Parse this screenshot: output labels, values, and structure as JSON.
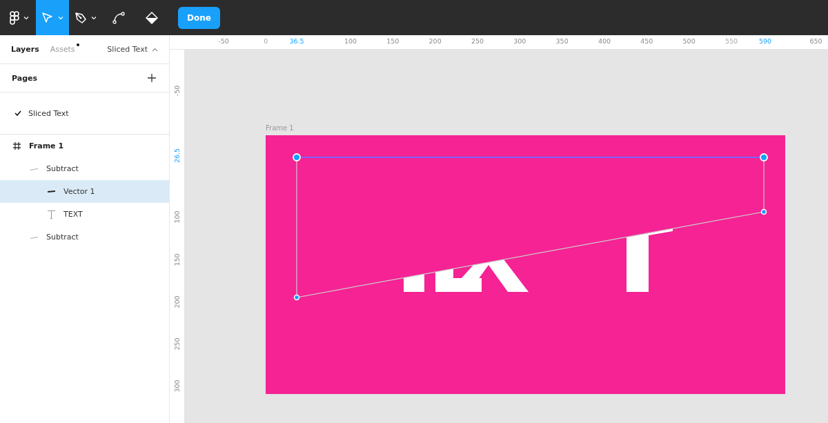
{
  "toolbar": {
    "tools": [
      {
        "kind": "main-menu",
        "selected": false,
        "caret": true
      },
      {
        "kind": "move",
        "selected": true,
        "caret": true
      },
      {
        "kind": "pen",
        "selected": false,
        "caret": true
      },
      {
        "kind": "bend",
        "selected": false,
        "caret": false
      },
      {
        "kind": "paint-bucket",
        "selected": false,
        "caret": false
      }
    ],
    "done_button": "Done"
  },
  "panel": {
    "tabs": [
      {
        "label": "Layers",
        "selected": true,
        "dot": false
      },
      {
        "label": "Assets",
        "selected": false,
        "dot": true
      }
    ],
    "page_switcher": "Sliced Text",
    "pages_title": "Pages",
    "pages": [
      {
        "name": "Sliced Text",
        "selected": true
      }
    ],
    "layers": [
      {
        "name": "Frame 1",
        "kind": "frame",
        "selected": false,
        "children": [
          {
            "name": "Subtract",
            "kind": "boolean",
            "selected": false,
            "children": [
              {
                "name": "Vector 1",
                "kind": "vector",
                "selected": true
              },
              {
                "name": "TEXT",
                "kind": "text",
                "selected": false
              }
            ]
          },
          {
            "name": "Subtract",
            "kind": "boolean",
            "selected": false
          }
        ]
      }
    ]
  },
  "rulers": {
    "horizontal": [
      {
        "label": "-50",
        "kind": "normal"
      },
      {
        "label": "0",
        "kind": "faded"
      },
      {
        "label": "36.5",
        "kind": "highlight"
      },
      {
        "label": "100",
        "kind": "normal"
      },
      {
        "label": "150",
        "kind": "normal"
      },
      {
        "label": "200",
        "kind": "normal"
      },
      {
        "label": "250",
        "kind": "normal"
      },
      {
        "label": "300",
        "kind": "normal"
      },
      {
        "label": "350",
        "kind": "normal"
      },
      {
        "label": "400",
        "kind": "normal"
      },
      {
        "label": "450",
        "kind": "normal"
      },
      {
        "label": "500",
        "kind": "normal"
      },
      {
        "label": "550",
        "kind": "faded"
      },
      {
        "label": "590",
        "kind": "highlight"
      },
      {
        "label": "650",
        "kind": "normal"
      }
    ],
    "vertical": [
      {
        "label": "-50",
        "kind": "normal"
      },
      {
        "label": "26.5",
        "kind": "highlight"
      },
      {
        "label": "100",
        "kind": "normal"
      },
      {
        "label": "150",
        "kind": "normal"
      },
      {
        "label": "200",
        "kind": "normal"
      },
      {
        "label": "250",
        "kind": "normal"
      },
      {
        "label": "300",
        "kind": "normal"
      }
    ]
  },
  "canvas": {
    "frame_label": "Frame 1"
  }
}
